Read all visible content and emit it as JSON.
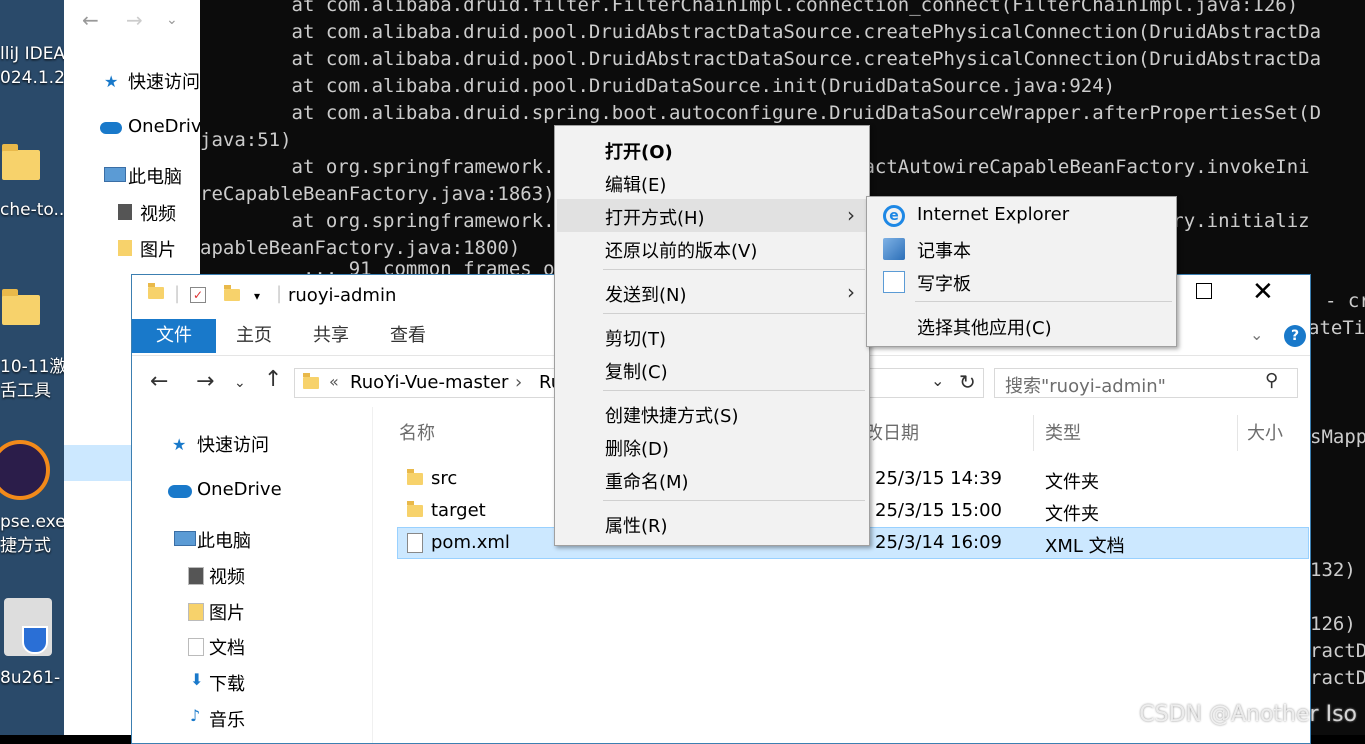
{
  "desktop": {
    "labels": [
      "lliJ IDEA",
      "024.1.2",
      "che-to...",
      "10-11激",
      "舌工具",
      "pse.exe",
      "捷方式",
      "8u261-"
    ]
  },
  "back_explorer": {
    "items": [
      "快速访问",
      "OneDriv",
      "此电脑",
      "视频",
      "图片"
    ]
  },
  "console": {
    "lines": [
      "        at com.alibaba.druid.filter.FilterChainImpl.connection_connect(FilterChainImpl.java:126)",
      "        at com.alibaba.druid.pool.DruidAbstractDataSource.createPhysicalConnection(DruidAbstractDa",
      "        at com.alibaba.druid.pool.DruidAbstractDataSource.createPhysicalConnection(DruidAbstractDa",
      "        at com.alibaba.druid.pool.DruidDataSource.init(DruidDataSource.java:924)",
      "        at com.alibaba.druid.spring.boot.autoconfigure.DruidDataSourceWrapper.afterPropertiesSet(D",
      "java:51)",
      "        at org.springframework.beans.factory.support.AbstractAutowireCapableBeanFactory.invokeIni",
      "reCapableBeanFactory.java:1863)",
      "        at org.springframework.beans.factory.support.AbstractAutowireCapableBeanFactory.initializ",
      "apableBeanFactory.java:1800)",
      "         ... 91 common frames omitted"
    ],
    "right_fragments": [
      "- cr",
      "ateTim",
      "sMapp",
      "132)",
      "126)",
      "ractDa",
      "ractDa"
    ]
  },
  "explorer": {
    "title": "ruoyi-admin",
    "ribbon_tabs": [
      "文件",
      "主页",
      "共享",
      "查看"
    ],
    "address": [
      "«",
      "RuoYi-Vue-master",
      "›",
      "Ru"
    ],
    "search_placeholder": "搜索\"ruoyi-admin\"",
    "nav_items": [
      "快速访问",
      "OneDrive",
      "此电脑",
      "视频",
      "图片",
      "文档",
      "下载",
      "音乐"
    ],
    "columns": [
      "名称",
      "改日期",
      "类型",
      "大小"
    ],
    "files": [
      {
        "name": "src",
        "date": "25/3/15 14:39",
        "type": "文件夹"
      },
      {
        "name": "target",
        "date": "25/3/15 15:00",
        "type": "文件夹"
      },
      {
        "name": "pom.xml",
        "date": "25/3/14 16:09",
        "type": "XML 文档"
      }
    ]
  },
  "context_menu": {
    "items": [
      "打开(O)",
      "编辑(E)",
      "打开方式(H)",
      "还原以前的版本(V)",
      "发送到(N)",
      "剪切(T)",
      "复制(C)",
      "创建快捷方式(S)",
      "删除(D)",
      "重命名(M)",
      "属性(R)"
    ]
  },
  "submenu": {
    "items": [
      "Internet Explorer",
      "记事本",
      "写字板",
      "选择其他应用(C)"
    ]
  },
  "watermark": "CSDN @Another Iso"
}
